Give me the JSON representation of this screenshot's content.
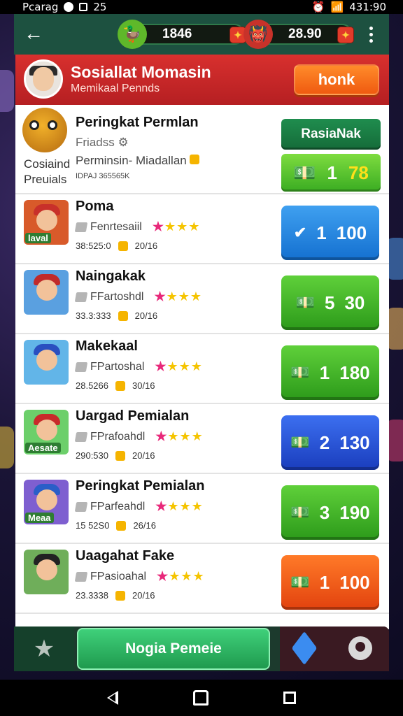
{
  "status": {
    "carrier": "Pcarag",
    "left_num": "25",
    "time": "431:90"
  },
  "topbar": {
    "currency1": {
      "value": "1846",
      "icon": "duck-icon"
    },
    "currency2": {
      "value": "28.90",
      "icon": "monster-icon"
    }
  },
  "header": {
    "title": "Sosiallat Momasin",
    "subtitle": "Memikaal Pennds",
    "button": "honk"
  },
  "first_row": {
    "title": "Peringkat Permlan",
    "line1": "Friadss",
    "line2": "Perminsin- Miadallan",
    "line3": "IDPAJ 365565K",
    "side_label_1": "Cosiaind",
    "side_label_2": "Preuials",
    "button_top": "RasiaNak",
    "button_bottom_a": "1",
    "button_bottom_b": "78"
  },
  "rows": [
    {
      "title": "Poma",
      "sub": "Fenrtesaiil",
      "meta_a": "38:525:0",
      "meta_b": "20/16",
      "tag": "laval",
      "btn_a": "1",
      "btn_b": "100",
      "color": "blue",
      "btn_icon": "check-icon"
    },
    {
      "title": "Naingakak",
      "sub": "FFartoshdl",
      "meta_a": "33.3:333",
      "meta_b": "20/16",
      "tag": "",
      "btn_a": "5",
      "btn_b": "30",
      "color": "green",
      "btn_icon": "cash-icon"
    },
    {
      "title": "Makekaal",
      "sub": "FPartoshal",
      "meta_a": "28.5266",
      "meta_b": "30/16",
      "tag": "",
      "btn_a": "1",
      "btn_b": "180",
      "color": "green",
      "btn_icon": "cash-icon"
    },
    {
      "title": "Uargad Pemialan",
      "sub": "FPrafoahdl",
      "meta_a": "290:530",
      "meta_b": "20/16",
      "tag": "Aesate",
      "btn_a": "2",
      "btn_b": "130",
      "color": "dblue",
      "btn_icon": "cash-icon"
    },
    {
      "title": "Peringkat Pemialan",
      "sub": "FParfeahdl",
      "meta_a": "15 52S0",
      "meta_b": "26/16",
      "tag": "Meaa",
      "btn_a": "3",
      "btn_b": "190",
      "color": "green",
      "btn_icon": "cash-icon"
    },
    {
      "title": "Uaagahat Fake",
      "sub": "FPasioahal",
      "meta_a": "23.3338",
      "meta_b": "20/16",
      "tag": "",
      "btn_a": "1",
      "btn_b": "100",
      "color": "orange",
      "btn_icon": "cash-icon"
    }
  ],
  "bottombar": {
    "main_button": "Nogia Pemeie"
  }
}
